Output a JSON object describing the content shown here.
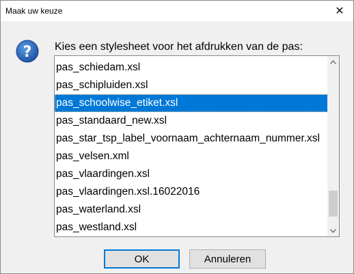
{
  "window": {
    "title": "Maak uw keuze",
    "close_glyph": "✕"
  },
  "prompt": "Kies een stylesheet voor het afdrukken van de pas:",
  "list": {
    "selected_index": 2,
    "items": [
      "pas_schiedam.xsl",
      "pas_schipluiden.xsl",
      "pas_schoolwise_etiket.xsl",
      "pas_standaard_new.xsl",
      "pas_star_tsp_label_voornaam_achternaam_nummer.xsl",
      "pas_velsen.xml",
      "pas_vlaardingen.xsl",
      "pas_vlaardingen.xsl.16022016",
      "pas_waterland.xsl",
      "pas_westland.xsl"
    ]
  },
  "buttons": {
    "ok_label": "OK",
    "cancel_label": "Annuleren"
  },
  "icons": {
    "dialog_icon": "question-icon",
    "scroll_up": "chevron-up-icon",
    "scroll_down": "chevron-down-icon"
  },
  "colors": {
    "selection": "#0078d7",
    "icon_blue": "#1f5fb4"
  }
}
